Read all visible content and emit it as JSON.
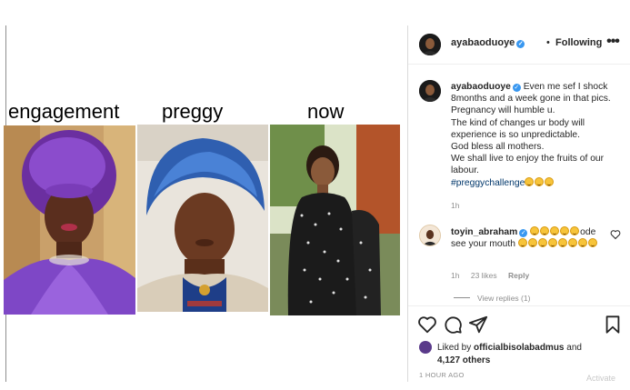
{
  "post": {
    "captions": [
      "engagement",
      "preggy",
      "now"
    ]
  },
  "header": {
    "username": "ayabaoduoye",
    "separator": "•",
    "follow_label": "Following",
    "more_icon": "more-horizontal-icon"
  },
  "caption": {
    "username": "ayabaoduoye",
    "lines": [
      "Even me sef I shock",
      "8months and a week gone in that pics.",
      "Pregnancy will humble u.",
      "The kind of changes ur body will",
      "experience is so unpredictable.",
      "God bless all mothers.",
      "We shall live to enjoy the fruits of our",
      "labour."
    ],
    "hashtag": "#preggychallenge",
    "time": "1h"
  },
  "comment": {
    "username": "toyin_abraham",
    "text_a": "ode",
    "text_b": "see your mouth",
    "time": "1h",
    "likes": "23 likes",
    "reply_label": "Reply",
    "view_replies": "View replies (1)"
  },
  "likes": {
    "prefix": "Liked by ",
    "user": "officialbisolabadmus",
    "and": " and",
    "others": "4,127 others"
  },
  "post_time": "1 HOUR AGO",
  "watermark": "Activate",
  "colors": {
    "link": "#00376b",
    "verified": "#3897f0",
    "muted": "#8e8e8e"
  }
}
